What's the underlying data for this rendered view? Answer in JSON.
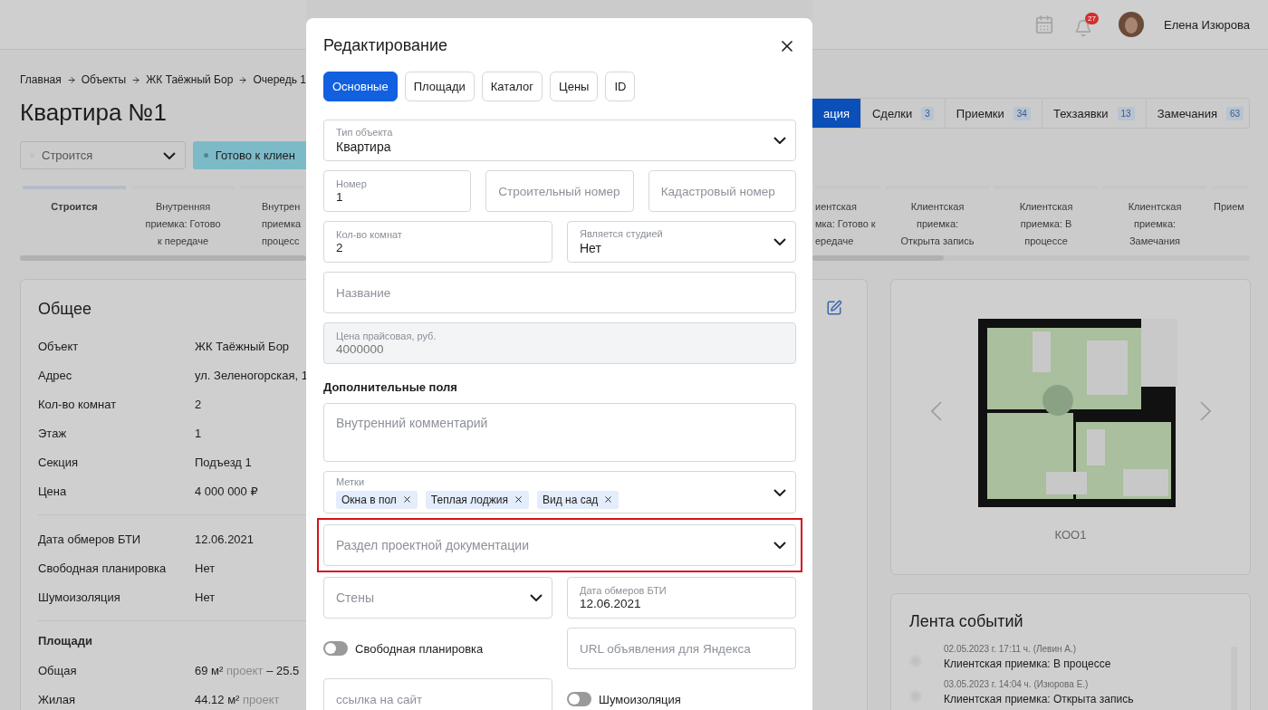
{
  "header": {
    "notifications": "27",
    "user_name": "Елена Изюрова"
  },
  "breadcrumbs": [
    "Главная",
    "Объекты",
    "ЖК Таёжный Бор",
    "Очередь 1"
  ],
  "title": "Квартира №1",
  "status": {
    "select": "Строится",
    "action": "Готово к клиен"
  },
  "tabs": [
    {
      "label": "ация",
      "selected": true
    },
    {
      "label": "Сделки",
      "count": "3",
      "selected": false
    },
    {
      "label": "Приемки",
      "count": "34",
      "selected": false
    },
    {
      "label": "Техзаявки",
      "count": "13",
      "selected": false
    },
    {
      "label": "Замечания",
      "count": "63",
      "selected": false
    }
  ],
  "stages": [
    {
      "kind": "full",
      "label": "Строится",
      "selected": true
    },
    {
      "kind": "full",
      "label": "Внутренняя приемка: Готово к передаче",
      "selected": false
    },
    {
      "kind": "clipped",
      "label": "Внутрен\nприемка\nпроцесс",
      "selected": false
    },
    {
      "kind": "clipped",
      "label": "иентская\nмка: Готово к\nередаче",
      "selected": false
    },
    {
      "kind": "full",
      "label": "Клиентская приемка: Открыта запись",
      "selected": false
    },
    {
      "kind": "full",
      "label": "Клиентская приемка: В процессе",
      "selected": false
    },
    {
      "kind": "full",
      "label": "Клиентская приемка: Замечания",
      "selected": false
    },
    {
      "kind": "clipped",
      "label": "Прием",
      "selected": false
    }
  ],
  "general": {
    "title": "Общее",
    "groups": [
      {
        "rows": [
          {
            "label": "Объект",
            "value": "ЖК Таёжный Бор"
          },
          {
            "label": "Адрес",
            "value": "ул. Зеленогорская, 1"
          },
          {
            "label": "Кол-во комнат",
            "value": "2"
          },
          {
            "label": "Этаж",
            "value": "1"
          },
          {
            "label": "Секция",
            "value": "Подъезд 1"
          },
          {
            "label": "Цена",
            "value": "4 000 000 ₽"
          }
        ]
      },
      {
        "rows": [
          {
            "label": "Дата обмеров БТИ",
            "value": "12.06.2021"
          },
          {
            "label": "Свободная планировка",
            "value": "Нет"
          },
          {
            "label": "Шумоизоляция",
            "value": "Нет"
          }
        ]
      },
      {
        "title": "Площади",
        "rows": [
          {
            "label": "Общая",
            "value": "69 м²",
            "note": "проект",
            "tail": "– 25.5"
          },
          {
            "label": "Жилая",
            "value": "44.12 м²",
            "note": "проект"
          }
        ]
      }
    ]
  },
  "plan": {
    "caption": "КОО1"
  },
  "feed": {
    "title": "Лента событий",
    "events": [
      {
        "meta": "02.05.2023 г. 17:11 ч. (Левин А.)",
        "text": "Клиентская приемка: В процессе"
      },
      {
        "meta": "03.05.2023 г. 14:04 ч. (Изюрова Е.)",
        "text": "Клиентская приемка: Открыта запись"
      }
    ]
  },
  "dialog": {
    "title": "Редактирование",
    "tabs": [
      {
        "label": "Основные",
        "selected": true
      },
      {
        "label": "Площади",
        "selected": false
      },
      {
        "label": "Каталог",
        "selected": false
      },
      {
        "label": "Цены",
        "selected": false
      },
      {
        "label": "ID",
        "selected": false
      }
    ],
    "rows": [
      {
        "kind": "fields",
        "fields": [
          {
            "kind": "select",
            "label": "Тип объекта",
            "value": "Квартира"
          }
        ]
      },
      {
        "kind": "fields",
        "fields": [
          {
            "kind": "input",
            "label": "Номер",
            "value": "1"
          },
          {
            "kind": "input",
            "placeholder": "Строительный номер"
          },
          {
            "kind": "input",
            "placeholder": "Кадастровый номер"
          }
        ]
      },
      {
        "kind": "fields",
        "fields": [
          {
            "kind": "input",
            "label": "Кол-во комнат",
            "value": "2"
          },
          {
            "kind": "select",
            "label": "Является студией",
            "value": "Нет"
          }
        ]
      },
      {
        "kind": "fields",
        "fields": [
          {
            "kind": "input",
            "placeholder": "Название"
          }
        ]
      },
      {
        "kind": "fields",
        "fields": [
          {
            "kind": "readonly",
            "label": "Цена прайсовая, руб.",
            "value": "4000000"
          }
        ]
      },
      {
        "kind": "heading",
        "text": "Дополнительные поля"
      },
      {
        "kind": "fields",
        "fields": [
          {
            "kind": "textarea",
            "placeholder": "Внутренний комментарий"
          }
        ]
      },
      {
        "kind": "fields",
        "fields": [
          {
            "kind": "tags",
            "label": "Метки",
            "tags": [
              "Окна в пол",
              "Теплая лоджия",
              "Вид на сад"
            ]
          }
        ]
      },
      {
        "kind": "fields",
        "highlighted": true,
        "fields": [
          {
            "kind": "select",
            "placeholder": "Раздел проектной документации"
          }
        ]
      },
      {
        "kind": "fields",
        "fields": [
          {
            "kind": "select",
            "placeholder": "Стены"
          },
          {
            "kind": "input",
            "label": "Дата обмеров БТИ",
            "value": "12.06.2021"
          }
        ]
      },
      {
        "kind": "fields",
        "fields": [
          {
            "kind": "toggle",
            "label": "Свободная планировка",
            "on": false
          },
          {
            "kind": "input",
            "placeholder": "URL объявления для Яндекса"
          }
        ]
      },
      {
        "kind": "fields",
        "fields": [
          {
            "kind": "input",
            "placeholder": "ссылка на сайт"
          },
          {
            "kind": "toggle",
            "label": "Шумоизоляция",
            "on": false
          }
        ]
      }
    ]
  }
}
